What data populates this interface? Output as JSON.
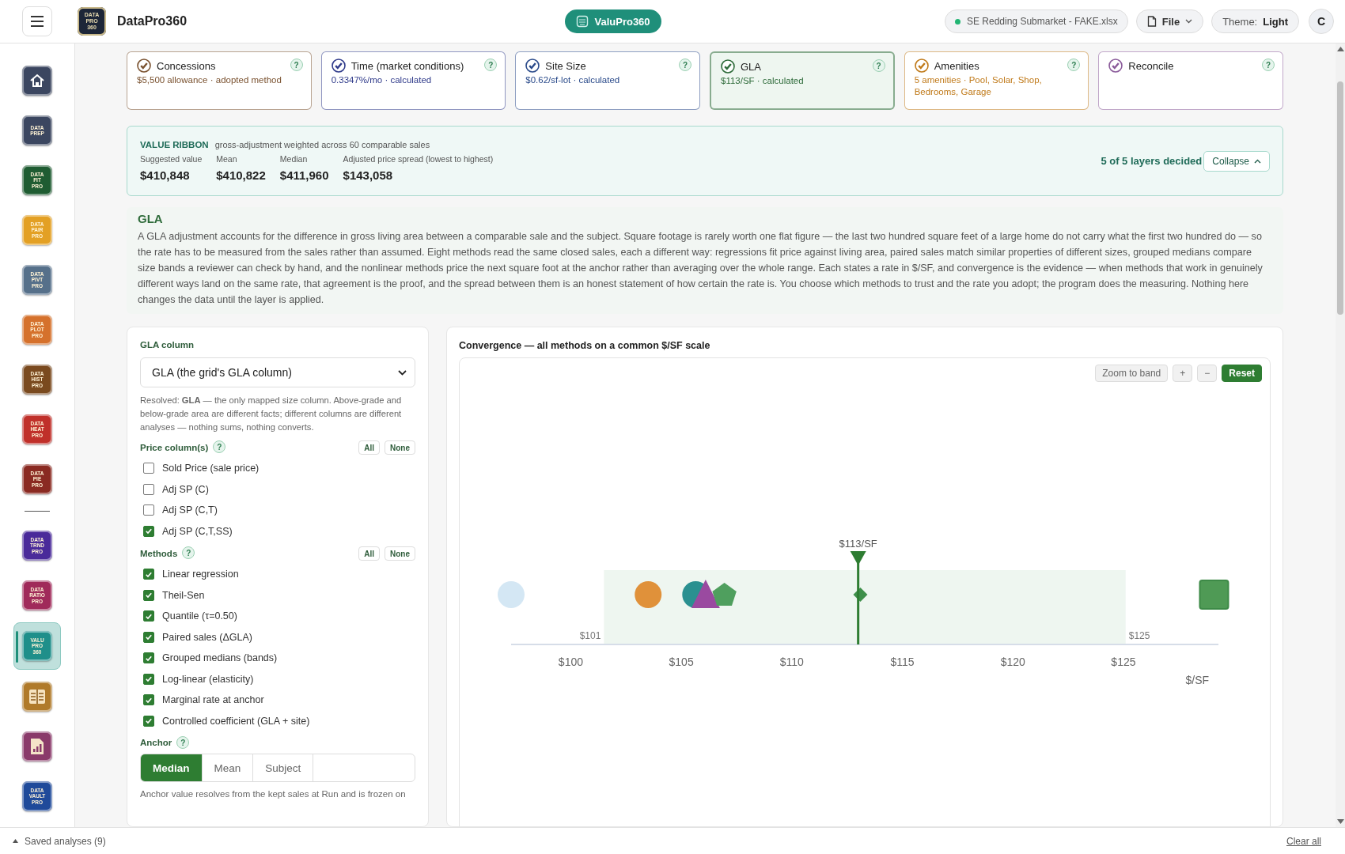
{
  "topbar": {
    "logo_lines": [
      "DATA",
      "PRO",
      "360"
    ],
    "app_name": "DataPro360",
    "module": "ValuPro360",
    "file_chip": "SE Redding Submarket - FAKE.xlsx",
    "file_menu": "File",
    "theme_label": "Theme:",
    "theme_value": "Light",
    "avatar": "C"
  },
  "sidebar": {
    "groups": [
      {
        "items": [
          {
            "kind": "home",
            "color": "#3b4660",
            "selected": false
          },
          {
            "kind": "app",
            "lines": [
              "DATA",
              "PREP"
            ],
            "color": "#3b4660",
            "selected": false
          },
          {
            "kind": "app",
            "lines": [
              "DATA",
              "FIT",
              "PRO"
            ],
            "color": "#1f5c32",
            "selected": false
          },
          {
            "kind": "app",
            "lines": [
              "DATA",
              "PAIR",
              "PRO"
            ],
            "color": "#e3a024",
            "selected": false
          },
          {
            "kind": "app",
            "lines": [
              "DATA",
              "PIVT",
              "PRO"
            ],
            "color": "#56708a",
            "selected": false
          },
          {
            "kind": "app",
            "lines": [
              "DATA",
              "PLOT",
              "PRO"
            ],
            "color": "#d5712c",
            "selected": false
          },
          {
            "kind": "app",
            "lines": [
              "DATA",
              "HIST",
              "PRO"
            ],
            "color": "#7a4a1f",
            "selected": false
          },
          {
            "kind": "app",
            "lines": [
              "DATA",
              "HEAT",
              "PRO"
            ],
            "color": "#c0302a",
            "selected": false
          },
          {
            "kind": "app",
            "lines": [
              "DATA",
              "PIE",
              "PRO"
            ],
            "color": "#8a2a22",
            "selected": false
          }
        ]
      },
      {
        "items": [
          {
            "kind": "app",
            "lines": [
              "DATA",
              "TRND",
              "PRO"
            ],
            "color": "#4a2a9a",
            "selected": false
          },
          {
            "kind": "app",
            "lines": [
              "DATA",
              "RATIO",
              "PRO"
            ],
            "color": "#a02a5a",
            "selected": false
          },
          {
            "kind": "app",
            "lines": [
              "VALU",
              "PRO",
              "360"
            ],
            "color": "#1f8f8a",
            "selected": true
          },
          {
            "kind": "grid",
            "color": "#b07a2a",
            "selected": false
          },
          {
            "kind": "report",
            "color": "#8a3a6a",
            "selected": false
          },
          {
            "kind": "app",
            "lines": [
              "DATA",
              "VAULT",
              "PRO"
            ],
            "color": "#1f4a9a",
            "selected": false
          }
        ]
      }
    ]
  },
  "layers": [
    {
      "title": "Concessions",
      "summary": "$5,500 allowance · adopted method",
      "color": "#7a5230",
      "selected": false,
      "help": "?"
    },
    {
      "title": "Time (market conditions)",
      "summary": "0.3347%/mo · calculated",
      "color": "#2f3a8a",
      "selected": false,
      "help": "?"
    },
    {
      "title": "Site Size",
      "summary": "$0.62/sf-lot · calculated",
      "color": "#2a4a8a",
      "selected": false,
      "help": "?"
    },
    {
      "title": "GLA",
      "summary": "$113/SF · calculated",
      "color": "#2e6b3a",
      "selected": true,
      "help": "?"
    },
    {
      "title": "Amenities",
      "summary": "5 amenities · Pool, Solar, Shop, Bedrooms, Garage",
      "color": "#c07a1a",
      "selected": false,
      "help": "?"
    },
    {
      "title": "Reconcile",
      "color": "#8a5a9a",
      "selected": false,
      "help": "?"
    }
  ],
  "ribbon": {
    "title": "VALUE RIBBON",
    "subtitle": "gross-adjustment weighted across 60 comparable sales",
    "stats": [
      {
        "label": "Suggested value",
        "value": "$410,848"
      },
      {
        "label": "Mean",
        "value": "$410,822"
      },
      {
        "label": "Median",
        "value": "$411,960"
      },
      {
        "label": "Adjusted price spread (lowest to highest)",
        "value": "$143,058"
      }
    ],
    "status": "5 of 5 layers decided",
    "collapse": "Collapse"
  },
  "section": {
    "title": "GLA",
    "body": "A GLA adjustment accounts for the difference in gross living area between a comparable sale and the subject. Square footage is rarely worth one flat figure — the last two hundred square feet of a large home do not carry what the first two hundred do — so the rate has to be measured from the sales rather than assumed. Eight methods read the same closed sales, each a different way: regressions fit price against living area, paired sales match similar properties of different sizes, grouped medians compare size bands a reviewer can check by hand, and the nonlinear methods price the next square foot at the anchor rather than averaging over the whole range. Each states a rate in $/SF, and convergence is the evidence — when methods that work in genuinely different ways land on the same rate, that agreement is the proof, and the spread between them is an honest statement of how certain the rate is. You choose which methods to trust and the rate you adopt; the program does the measuring. Nothing here changes the data until the layer is applied."
  },
  "settings": {
    "column_label": "GLA column",
    "column_value": "GLA (the grid's GLA column)",
    "resolved": "Resolved: **GLA** — the only mapped size column. Above-grade and below-grade area are different facts; different columns are different analyses — nothing sums, nothing converts.",
    "price": {
      "label": "Price column(s)",
      "help": "?",
      "all": "All",
      "none": "None",
      "items": [
        {
          "label": "Sold Price (sale price)",
          "checked": false
        },
        {
          "label": "Adj SP (C)",
          "checked": false
        },
        {
          "label": "Adj SP (C,T)",
          "checked": false
        },
        {
          "label": "Adj SP (C,T,SS)",
          "checked": true
        }
      ]
    },
    "methods": {
      "label": "Methods",
      "help": "?",
      "all": "All",
      "none": "None",
      "items": [
        {
          "label": "Linear regression",
          "checked": true
        },
        {
          "label": "Theil-Sen",
          "checked": true
        },
        {
          "label": "Quantile (τ=0.50)",
          "checked": true
        },
        {
          "label": "Paired sales (ΔGLA)",
          "checked": true
        },
        {
          "label": "Grouped medians (bands)",
          "checked": true
        },
        {
          "label": "Log-linear (elasticity)",
          "checked": true
        },
        {
          "label": "Marginal rate at anchor",
          "checked": true
        },
        {
          "label": "Controlled coefficient (GLA + site)",
          "checked": true
        }
      ]
    },
    "anchor": {
      "label": "Anchor",
      "help": "?",
      "options": [
        {
          "label": "Median",
          "selected": true
        },
        {
          "label": "Mean",
          "selected": false
        },
        {
          "label": "Subject",
          "selected": false
        }
      ],
      "note": "Anchor value resolves from the kept sales at Run and is frozen on"
    }
  },
  "convergence": {
    "title": "Convergence — all methods on a common $/SF scale",
    "tools": [
      {
        "kind": "text",
        "label": "Zoom to band"
      },
      {
        "kind": "text",
        "label": "+"
      },
      {
        "kind": "text",
        "label": "−"
      },
      {
        "kind": "primary",
        "label": "Reset"
      }
    ],
    "chart_data": {
      "type": "scatter",
      "orientation": "horizontal",
      "categories": [
        null
      ],
      "xlabel": "$/SF",
      "xlim": [
        97.3,
        129.3
      ],
      "xticks": [
        {
          "value": 100,
          "label": "$100"
        },
        {
          "value": 105,
          "label": "$105"
        },
        {
          "value": 110,
          "label": "$110"
        },
        {
          "value": 115,
          "label": "$115"
        },
        {
          "value": 120,
          "label": "$120"
        },
        {
          "value": 125,
          "label": "$125"
        }
      ],
      "series": [
        {
          "color": "#d4e7f4",
          "values": [
            97.3
          ]
        },
        {
          "color": "#e0913a",
          "values": [
            103.5
          ]
        },
        {
          "color": "#2a9090",
          "values": [
            105.65
          ]
        },
        {
          "color": "#9a4aa0",
          "values": [
            106.1
          ]
        },
        {
          "color": "#4f9f5e",
          "values": [
            106.95
          ]
        },
        {
          "color": "#3e8f4a",
          "values": [
            113.1
          ]
        },
        {
          "color": "#4f9a55",
          "values": [
            129.1
          ]
        }
      ],
      "bands": [
        {
          "axis": "x",
          "from": 101.5,
          "to": 125.1
        }
      ],
      "annotations": [
        "$101",
        "$125"
      ],
      "ref_lines": [
        {
          "axis": "x",
          "value": 113,
          "label": "$113/SF"
        }
      ]
    }
  },
  "footer": {
    "saved": "Saved analyses (9)",
    "clear": "Clear all"
  }
}
